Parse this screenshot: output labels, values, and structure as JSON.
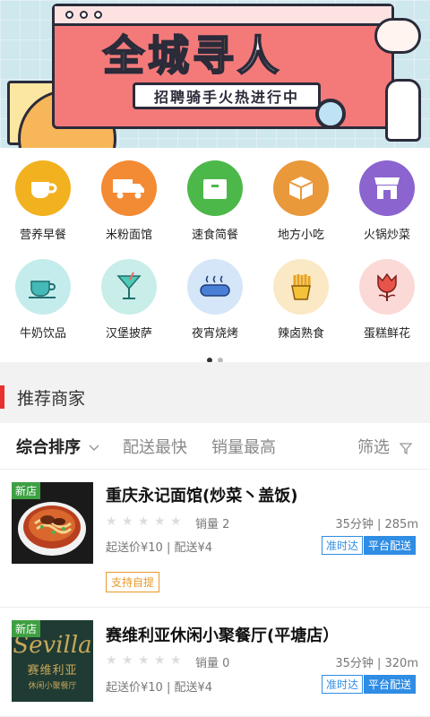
{
  "banner": {
    "title_part1": "全城",
    "title_highlight": "寻",
    "title_part2": "人",
    "subtitle": "招聘骑手火热进行中"
  },
  "categories": [
    {
      "label": "营养早餐",
      "icon": "coffee-cup-icon",
      "color": "#f2b11f"
    },
    {
      "label": "米粉面馆",
      "icon": "delivery-truck-icon",
      "color": "#f38a34"
    },
    {
      "label": "速食简餐",
      "icon": "box-icon",
      "color": "#4cb849"
    },
    {
      "label": "地方小吃",
      "icon": "package-icon",
      "color": "#e9983a"
    },
    {
      "label": "火锅炒菜",
      "icon": "storefront-icon",
      "color": "#8b64cf"
    },
    {
      "label": "牛奶饮品",
      "icon": "tea-cup-icon",
      "color": "#c5ecec"
    },
    {
      "label": "汉堡披萨",
      "icon": "cocktail-icon",
      "color": "#c9ede8"
    },
    {
      "label": "夜宵烧烤",
      "icon": "sausage-icon",
      "color": "#d4e6f7"
    },
    {
      "label": "辣卤熟食",
      "icon": "fries-icon",
      "color": "#fbe8c4"
    },
    {
      "label": "蛋糕鲜花",
      "icon": "tulip-icon",
      "color": "#fbd9d6"
    }
  ],
  "pager": {
    "active_color": "#333333",
    "inactive_color": "#bbbbbb"
  },
  "section": {
    "title": "推荐商家",
    "accent": "#e8302e"
  },
  "sort": {
    "comprehensive": "综合排序",
    "fastest": "配送最快",
    "top_sales": "销量最高",
    "filter": "筛选"
  },
  "stores": [
    {
      "name": "重庆永记面馆(炒菜丶盖饭)",
      "badge": "新店",
      "rating": 0,
      "sales": "销量 2",
      "time_distance": "35分钟 | 285m",
      "fees": "起送价¥10 | 配送¥4",
      "tag_ontime": "准时达",
      "tag_platform": "平台配送",
      "tag_pickup": "支持自提"
    },
    {
      "name": "赛维利亚休闲小聚餐厅(平塘店）",
      "badge": "新店",
      "rating": 0,
      "sales": "销量 0",
      "time_distance": "35分钟 | 320m",
      "fees": "起送价¥10 | 配送¥4",
      "tag_ontime": "准时达",
      "tag_platform": "平台配送",
      "logo_text_cn": "赛维利亚",
      "logo_text_cn_sub": "休闲小聚餐厅",
      "logo_text_en": "Sevilla"
    }
  ]
}
